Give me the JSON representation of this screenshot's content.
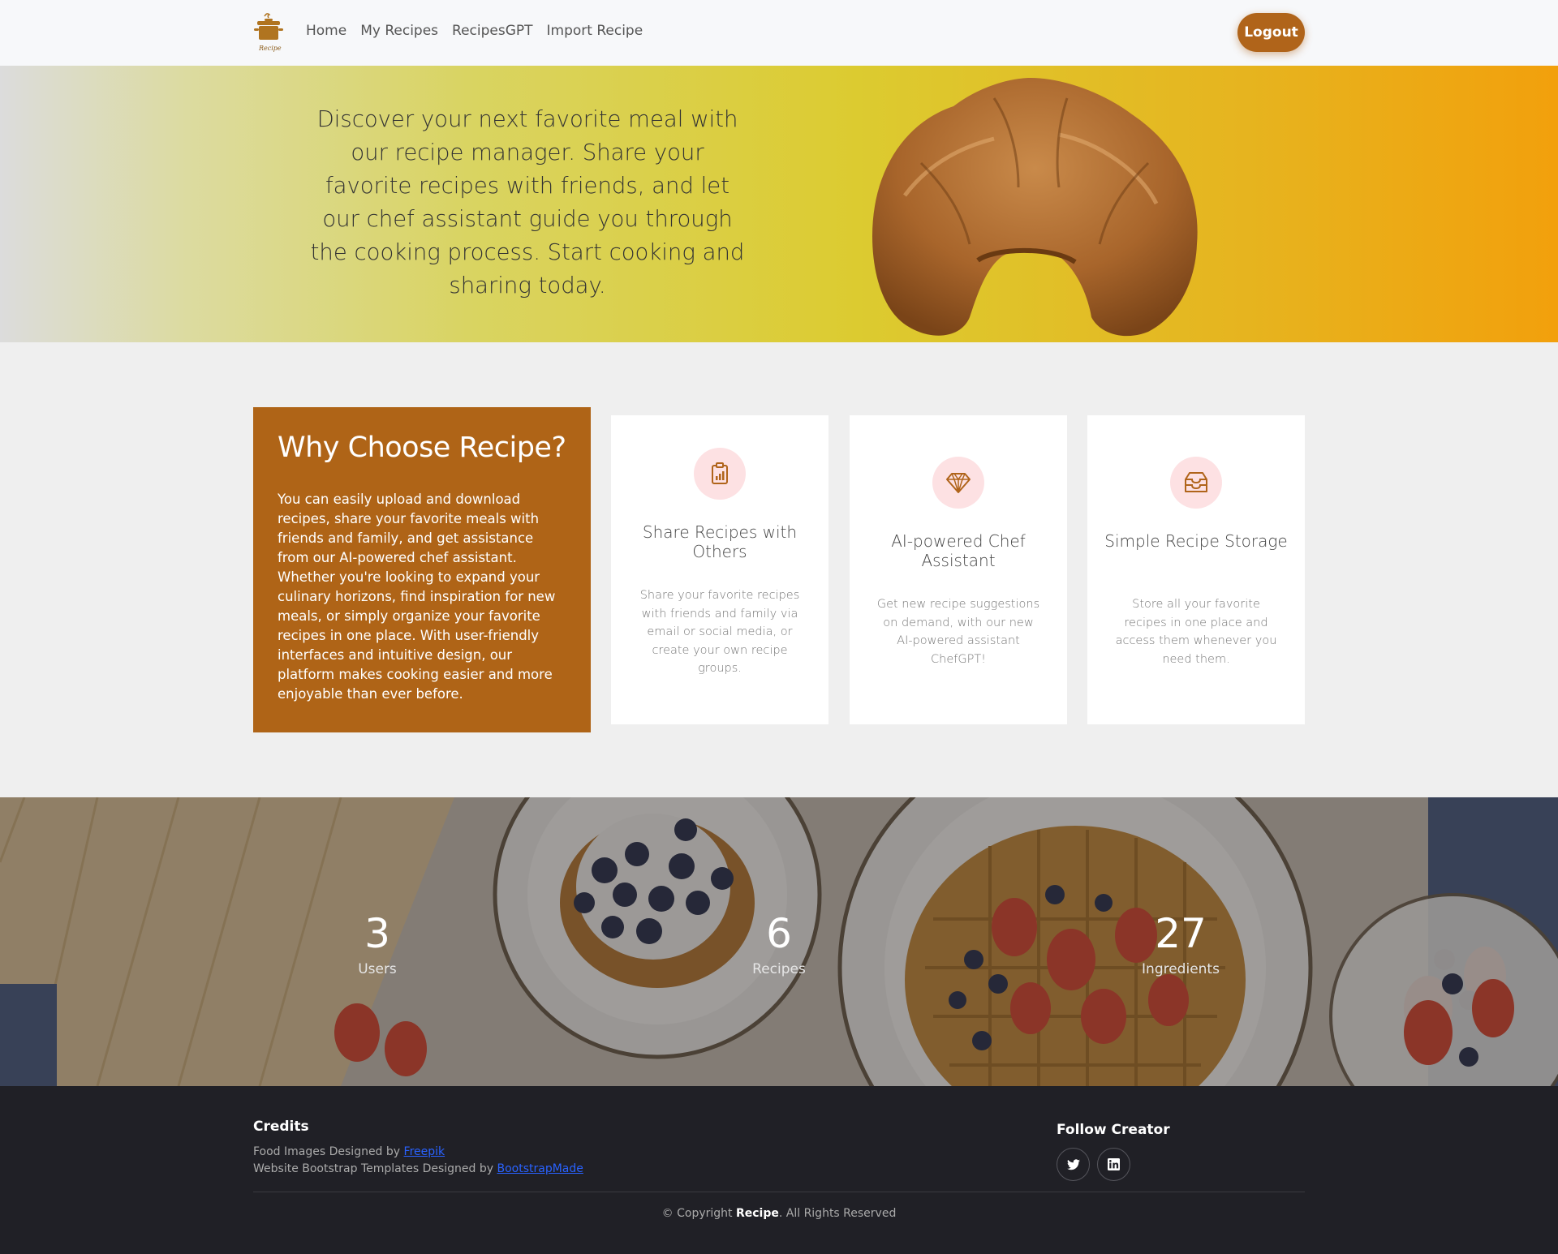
{
  "header": {
    "logo_text": "Recipe",
    "nav": [
      "Home",
      "My Recipes",
      "RecipesGPT",
      "Import Recipe"
    ],
    "logout_label": "Logout",
    "accent": "#b0641a"
  },
  "hero": {
    "text": "Discover your next favorite meal with our recipe manager. Share your favorite recipes with friends, and let our chef assistant guide you through the cooking process. Start cooking and sharing today."
  },
  "why": {
    "title": "Why Choose Recipe?",
    "text": "You can easily upload and download recipes, share your favorite meals with friends and family, and get assistance from our AI-powered chef assistant. Whether you're looking to expand your culinary horizons, find inspiration for new meals, or simply organize your favorite recipes in one place. With user-friendly interfaces and intuitive design, our platform makes cooking easier and more enjoyable than ever before."
  },
  "features": [
    {
      "icon": "clipboard-chart-icon",
      "title": "Share Recipes with Others",
      "desc": "Share your favorite recipes with friends and family via email or social media, or create your own recipe groups."
    },
    {
      "icon": "diamond-icon",
      "title": "AI-powered Chef Assistant",
      "desc": "Get new recipe suggestions on demand, with our new AI-powered assistant ChefGPT!"
    },
    {
      "icon": "inbox-storage-icon",
      "title": "Simple Recipe Storage",
      "desc": "Store all your favorite recipes in one place and access them whenever you need them."
    }
  ],
  "stats": [
    {
      "value": "3",
      "label": "Users"
    },
    {
      "value": "6",
      "label": "Recipes"
    },
    {
      "value": "27",
      "label": "Ingredients"
    }
  ],
  "footer": {
    "credits_title": "Credits",
    "credit1_prefix": "Food Images Designed by ",
    "credit1_link": "Freepik",
    "credit2_prefix": "Website Bootstrap Templates Designed by ",
    "credit2_link": "BootstrapMade",
    "follow_title": "Follow Creator",
    "social": [
      "twitter-icon",
      "linkedin-icon"
    ],
    "copyright_prefix": "© Copyright ",
    "copyright_brand": "Recipe",
    "copyright_suffix": ". All Rights Reserved",
    "link_color": "#2962ff"
  }
}
